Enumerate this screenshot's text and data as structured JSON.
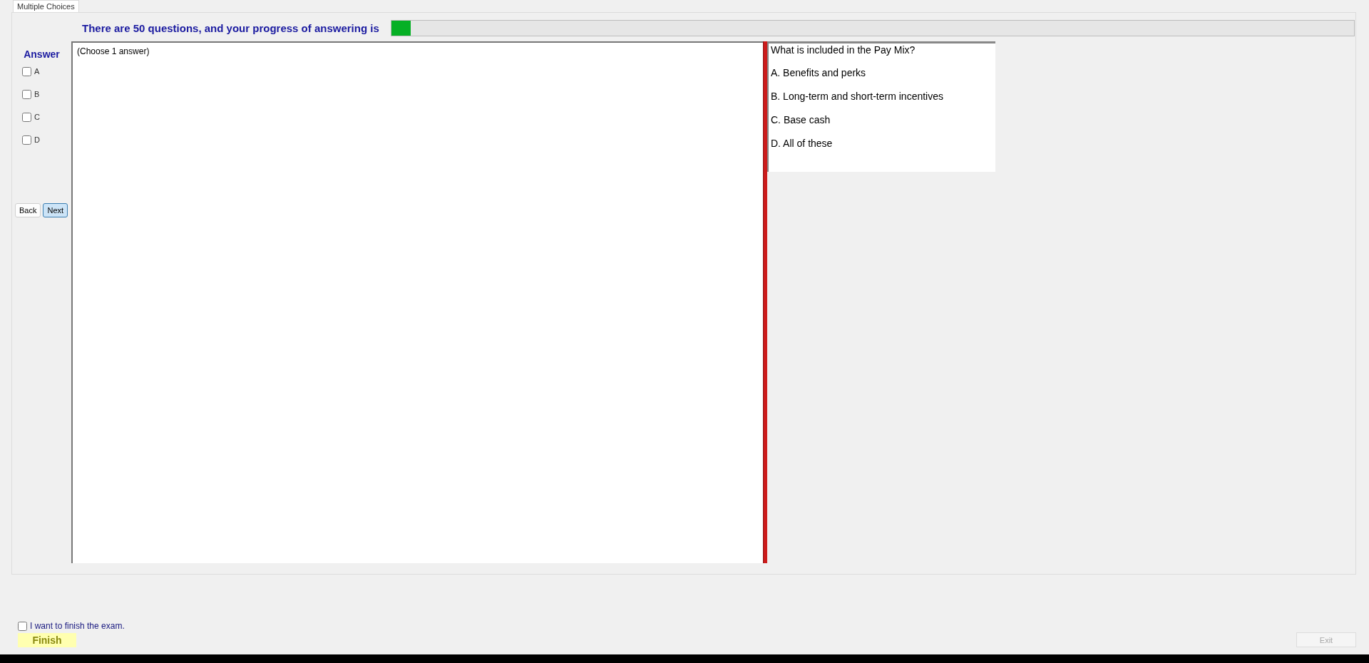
{
  "tabs": [
    {
      "label": "Multiple Choices",
      "selected": true
    }
  ],
  "progress": {
    "text": "There are 50 questions, and your progress of answering is",
    "level": 0.02
  },
  "answer_panel": {
    "title": "Answer",
    "options": [
      {
        "label": "A",
        "checked": false
      },
      {
        "label": "B",
        "checked": false
      },
      {
        "label": "C",
        "checked": false
      },
      {
        "label": "D",
        "checked": false
      }
    ],
    "buttons": [
      {
        "label": "Back",
        "selected": false
      },
      {
        "label": "Next",
        "selected": true
      }
    ]
  },
  "instruction": "(Choose 1 answer)",
  "question": {
    "text": "What is included in the Pay Mix?",
    "choices": [
      "A.  Benefits and perks",
      "B.  Long-term and short-term incentives",
      "C.  Base cash",
      "D.  All of these"
    ]
  },
  "finish": {
    "confirm_label": "I want to finish the exam.",
    "confirm_checked": false,
    "finish_button": "Finish",
    "exit_button": "Exit",
    "exit_disabled": true
  }
}
